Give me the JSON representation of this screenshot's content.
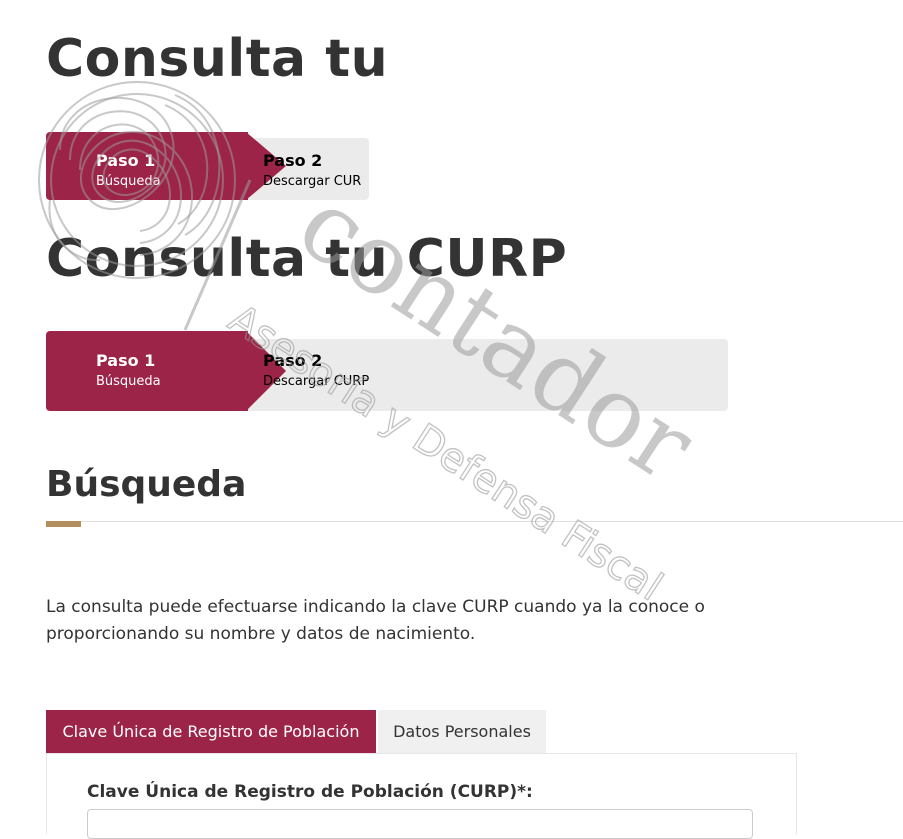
{
  "overlap_copy": {
    "title": "Consulta tu",
    "steps": [
      {
        "title": "Paso 1",
        "subtitle": "Búsqueda"
      },
      {
        "title": "Paso 2",
        "subtitle": "Descargar CUR"
      }
    ]
  },
  "page_title": "Consulta tu CURP",
  "steps": [
    {
      "title": "Paso 1",
      "subtitle": "Búsqueda"
    },
    {
      "title": "Paso 2",
      "subtitle": "Descargar CURP"
    }
  ],
  "section": {
    "title": "Búsqueda",
    "description": "La consulta puede efectuarse indicando la clave CURP cuando ya la conoce o proporcionando su nombre y datos de nacimiento."
  },
  "tabs": [
    {
      "label": "Clave Única de Registro de Población"
    },
    {
      "label": "Datos Personales"
    }
  ],
  "form": {
    "curp_label": "Clave Única de Registro de Población (CURP)*:",
    "curp_value": ""
  },
  "watermark": {
    "brand": "contador",
    "tagline": "Asesoría y Defensa Fiscal"
  },
  "colors": {
    "primary": "#9d2449",
    "accent": "#b38e5d",
    "step_track": "#ebebeb",
    "text": "#333333"
  },
  "icons": {
    "watermark_logo": "knot-seal-icon"
  }
}
